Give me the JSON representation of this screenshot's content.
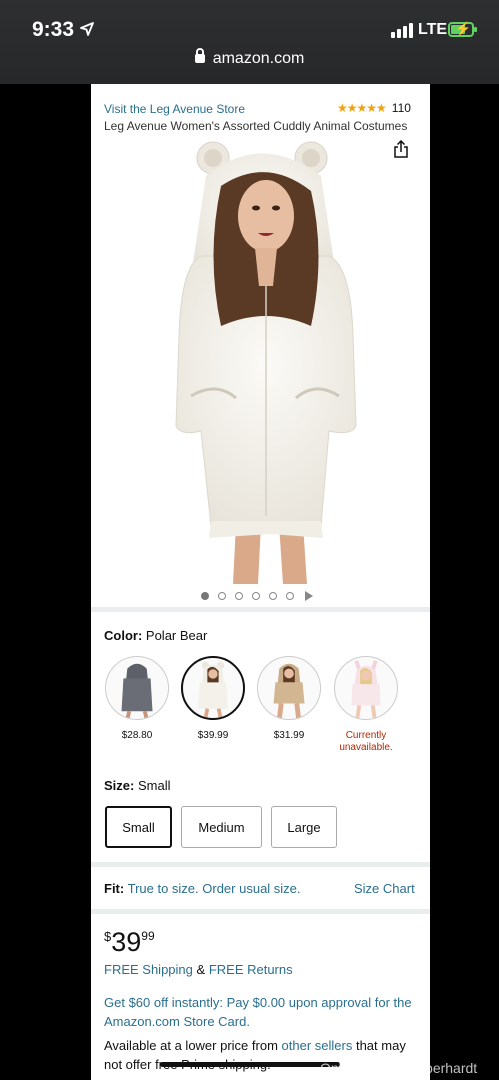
{
  "status_bar": {
    "time": "9:33",
    "network": "LTE",
    "url": "amazon.com"
  },
  "product": {
    "store_link": "Visit the Leg Avenue Store",
    "rating_count": "110",
    "stars": "★★★★★",
    "title": "Leg Avenue Women's Assorted Cuddly Animal Costumes",
    "image_count": 6,
    "active_image_index": 0
  },
  "color": {
    "label": "Color:",
    "value": "Polar Bear",
    "options": [
      {
        "price": "$28.80",
        "swatch": "grey-hoodie"
      },
      {
        "price": "$39.99",
        "swatch": "white-bear",
        "selected": true
      },
      {
        "price": "$31.99",
        "swatch": "tan-bear"
      },
      {
        "price": "Currently unavailable.",
        "swatch": "pink-bunny",
        "unavailable": true
      }
    ]
  },
  "size": {
    "label": "Size:",
    "value": "Small",
    "options": [
      "Small",
      "Medium",
      "Large"
    ]
  },
  "fit": {
    "label": "Fit:",
    "text": "True to size. Order usual size.",
    "size_chart": "Size Chart"
  },
  "price": {
    "currency": "$",
    "whole": "39",
    "fraction": "99"
  },
  "shipping": {
    "free_shipping": "FREE Shipping",
    "amp": "&",
    "free_returns": "FREE Returns"
  },
  "promo": "Get $60 off instantly: Pay $0.00 upon approval for the Amazon.com Store Card.",
  "availability": {
    "prefix": "Available at a lower price from",
    "link": "other sellers",
    "suffix": "that may not offer free Prime shipping."
  },
  "watermark": "OnlyFans.com/piperhardt",
  "colors": {
    "link": "#2a6f8f",
    "star": "#f2a20d",
    "unavailable": "#b12704",
    "battery": "#5fd25f"
  }
}
